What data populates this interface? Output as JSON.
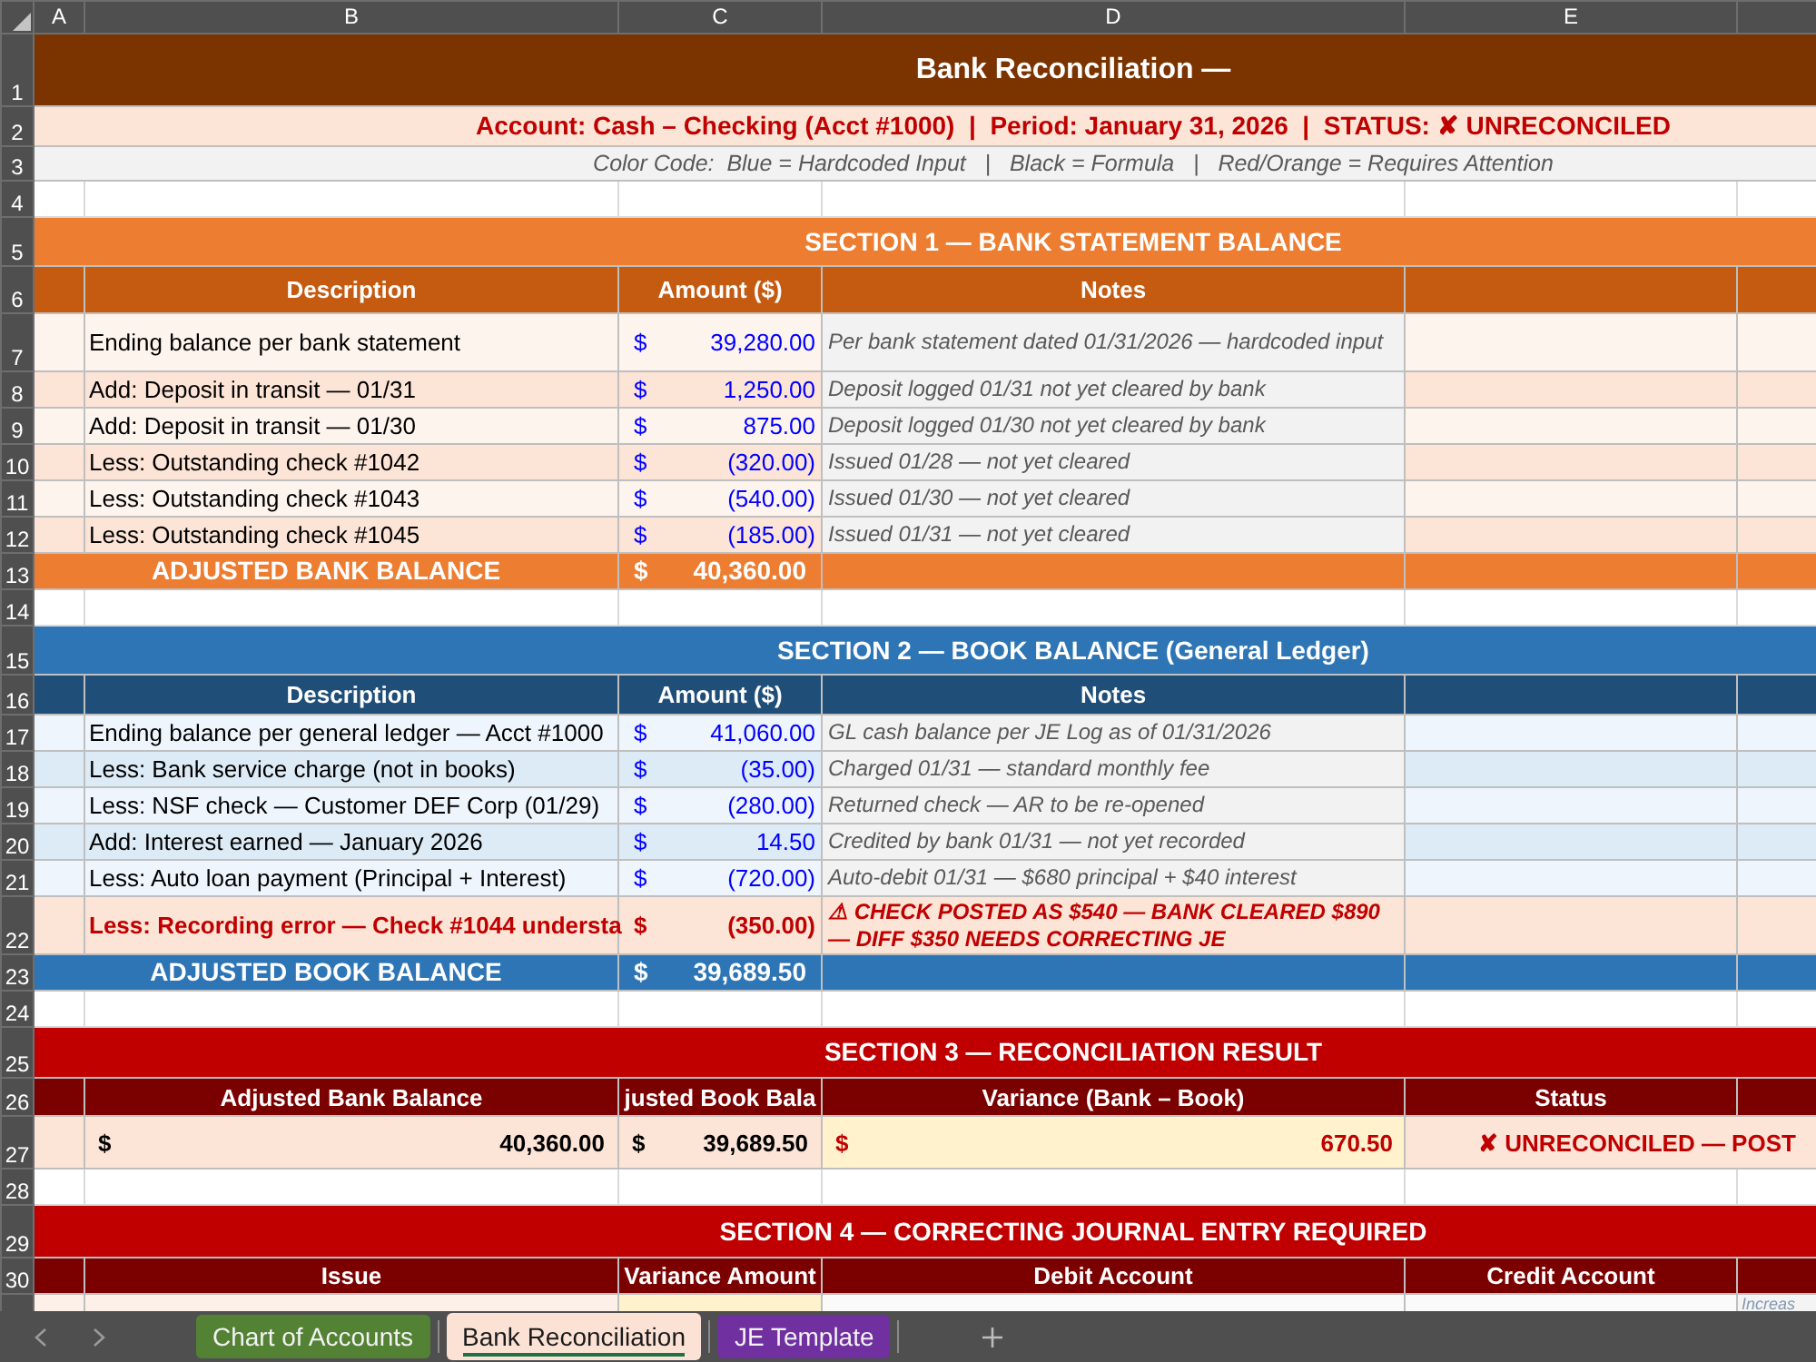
{
  "column_headers": [
    "A",
    "B",
    "C",
    "D",
    "E"
  ],
  "row_numbers": [
    "1",
    "2",
    "3",
    "4",
    "5",
    "6",
    "7",
    "8",
    "9",
    "10",
    "11",
    "12",
    "13",
    "14",
    "15",
    "16",
    "17",
    "18",
    "19",
    "20",
    "21",
    "22",
    "23",
    "24",
    "25",
    "26",
    "27",
    "28",
    "29",
    "30"
  ],
  "title": "Bank Reconciliation —",
  "account_line": "Account: Cash – Checking (Acct #1000)  |  Period: January 31, 2026  |  STATUS: ✘ UNRECONCILED",
  "color_code_line": "Color Code:  Blue = Hardcoded Input   |   Black = Formula   |   Red/Orange = Requires Attention",
  "sections": [
    {
      "kind": "bank",
      "title": "SECTION 1 — BANK STATEMENT BALANCE",
      "columns": [
        "Description",
        "Amount ($)",
        "Notes"
      ],
      "rows": [
        {
          "kind": "input",
          "description": "Ending balance per bank statement",
          "currency": "$",
          "amount": "39,280.00",
          "notes": "Per bank statement dated 01/31/2026 — hardcoded input"
        },
        {
          "kind": "input",
          "description": "Add: Deposit in transit — 01/31",
          "currency": "$",
          "amount": "1,250.00",
          "notes": "Deposit logged 01/31 not yet cleared by bank"
        },
        {
          "kind": "input",
          "description": "Add: Deposit in transit — 01/30",
          "currency": "$",
          "amount": "875.00",
          "notes": "Deposit logged 01/30 not yet cleared by bank"
        },
        {
          "kind": "input",
          "description": "Less: Outstanding check #1042",
          "currency": "$",
          "amount": "(320.00)",
          "notes": "Issued 01/28 — not yet cleared"
        },
        {
          "kind": "input",
          "description": "Less: Outstanding check #1043",
          "currency": "$",
          "amount": "(540.00)",
          "notes": "Issued 01/30 — not yet cleared"
        },
        {
          "kind": "input",
          "description": "Less: Outstanding check #1045",
          "currency": "$",
          "amount": "(185.00)",
          "notes": "Issued 01/31 — not yet cleared"
        }
      ],
      "total": {
        "label": "ADJUSTED BANK BALANCE",
        "currency": "$",
        "amount": "40,360.00"
      }
    },
    {
      "kind": "book",
      "title": "SECTION 2 — BOOK BALANCE (General Ledger)",
      "columns": [
        "Description",
        "Amount ($)",
        "Notes"
      ],
      "rows": [
        {
          "kind": "input",
          "description": "Ending balance per general ledger — Acct #1000",
          "currency": "$",
          "amount": "41,060.00",
          "notes": "GL cash balance per JE Log as of 01/31/2026"
        },
        {
          "kind": "input",
          "description": "Less: Bank service charge (not in books)",
          "currency": "$",
          "amount": "(35.00)",
          "notes": "Charged 01/31 — standard monthly fee"
        },
        {
          "kind": "input",
          "description": "Less: NSF check — Customer DEF Corp (01/29)",
          "currency": "$",
          "amount": "(280.00)",
          "notes": "Returned check — AR to be re-opened"
        },
        {
          "kind": "input",
          "description": "Add: Interest earned — January 2026",
          "currency": "$",
          "amount": "14.50",
          "notes": "Credited by bank 01/31 — not yet recorded"
        },
        {
          "kind": "input",
          "description": "Less: Auto loan payment (Principal + Interest)",
          "currency": "$",
          "amount": "(720.00)",
          "notes": "Auto-debit 01/31 — $680 principal + $40 interest"
        },
        {
          "kind": "error",
          "description": "Less: Recording error — Check #1044 understa",
          "currency": "$",
          "amount": "(350.00)",
          "notes": "⚠ CHECK POSTED AS $540 — BANK CLEARED $890 — DIFF $350 NEEDS CORRECTING JE"
        }
      ],
      "total": {
        "label": "ADJUSTED BOOK BALANCE",
        "currency": "$",
        "amount": "39,689.50"
      }
    }
  ],
  "result": {
    "title": "SECTION 3 — RECONCILIATION RESULT",
    "columns": [
      "Adjusted Bank Balance",
      "justed Book Bala",
      "Variance (Bank – Book)",
      "Status"
    ],
    "values": [
      {
        "kind": "formula",
        "currency": "$",
        "amount": "40,360.00"
      },
      {
        "kind": "formula",
        "currency": "$",
        "amount": "39,689.50"
      },
      {
        "kind": "attention",
        "currency": "$",
        "amount": "670.50"
      }
    ],
    "status": "✘ UNRECONCILED — POST"
  },
  "journal_entry": {
    "title": "SECTION 4 — CORRECTING JOURNAL ENTRY REQUIRED",
    "columns": [
      "Issue",
      "Variance Amount",
      "Debit Account",
      "Credit Account"
    ],
    "visible_row": {
      "column_f": "Increas"
    }
  },
  "sheet_tabs": [
    {
      "label": "Chart of Accounts",
      "color": "#548235",
      "selected": false
    },
    {
      "label": "Bank Reconciliation",
      "color": "#fbe2d5",
      "selected": true
    },
    {
      "label": "JE Template",
      "color": "#7030a0",
      "selected": false
    }
  ]
}
